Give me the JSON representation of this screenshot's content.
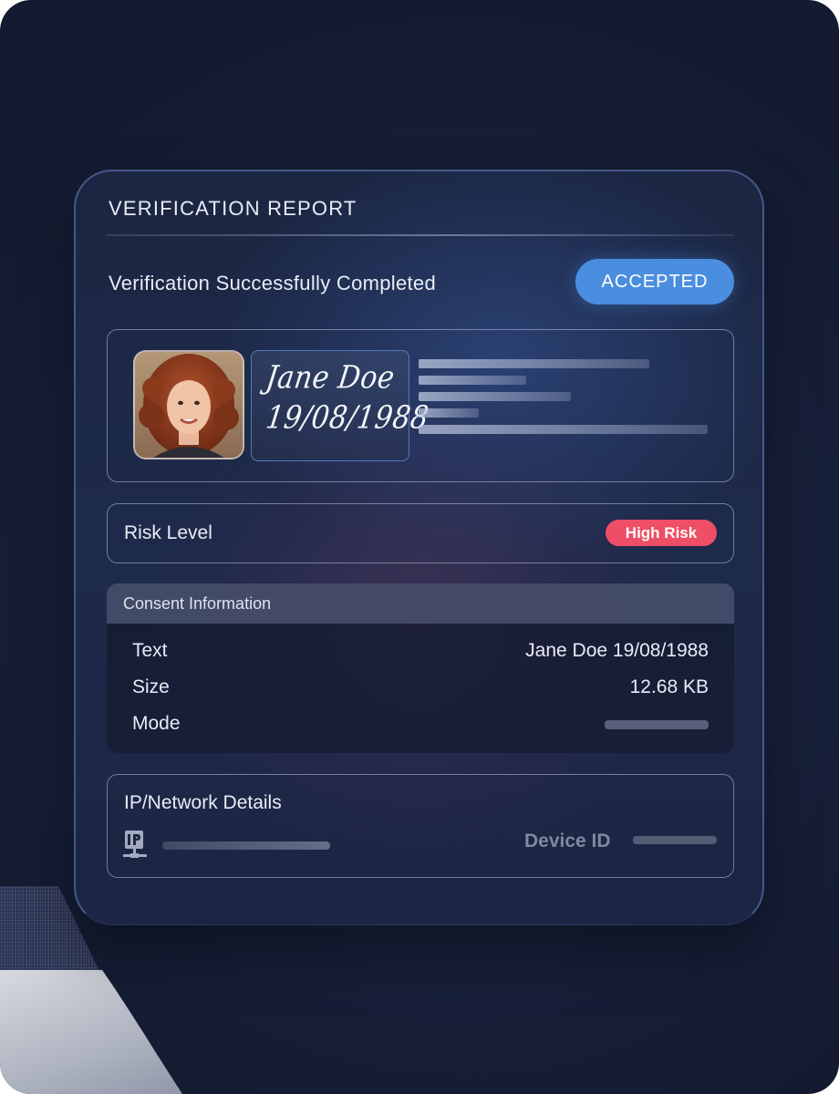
{
  "report": {
    "title": "VERIFICATION REPORT",
    "status_text": "Verification Successfully Completed",
    "status_badge": "ACCEPTED"
  },
  "id_card": {
    "signature_name": "Jane Doe",
    "signature_date": "19/08/1988"
  },
  "risk": {
    "label": "Risk Level",
    "badge": "High Risk"
  },
  "consent": {
    "title": "Consent Information",
    "rows": [
      {
        "label": "Text",
        "value": "Jane Doe 19/08/1988"
      },
      {
        "label": "Size",
        "value": "12.68 KB"
      },
      {
        "label": "Mode",
        "value": ""
      }
    ]
  },
  "network": {
    "title": "IP/Network Details",
    "device_label": "Device ID"
  },
  "colors": {
    "accepted": "#4a8ee0",
    "high_risk": "#ee4e66",
    "background": "#17203a"
  },
  "icons": [
    "ip-network-icon",
    "avatar-photo"
  ]
}
